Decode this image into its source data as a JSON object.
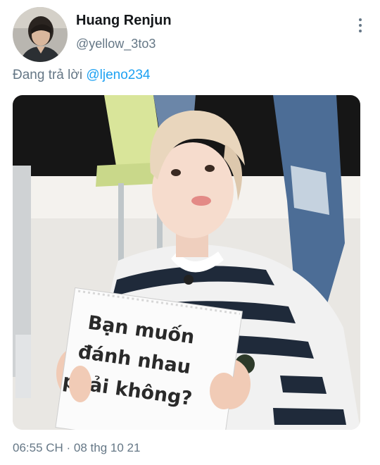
{
  "author": {
    "display_name": "Huang Renjun",
    "handle": "@yellow_3to3"
  },
  "reply": {
    "prefix": "Đang trả lời ",
    "mention": "@ljeno234"
  },
  "media": {
    "sign_lines": [
      "Bạn muốn",
      "đánh nhau",
      "phải không?"
    ]
  },
  "meta": {
    "timestamp": "06:55 CH · 08 thg 10 21"
  },
  "colors": {
    "link": "#1da1f2",
    "secondary_text": "#657786",
    "primary_text": "#14171a"
  },
  "icons": {
    "more": "more-vertical-icon"
  }
}
